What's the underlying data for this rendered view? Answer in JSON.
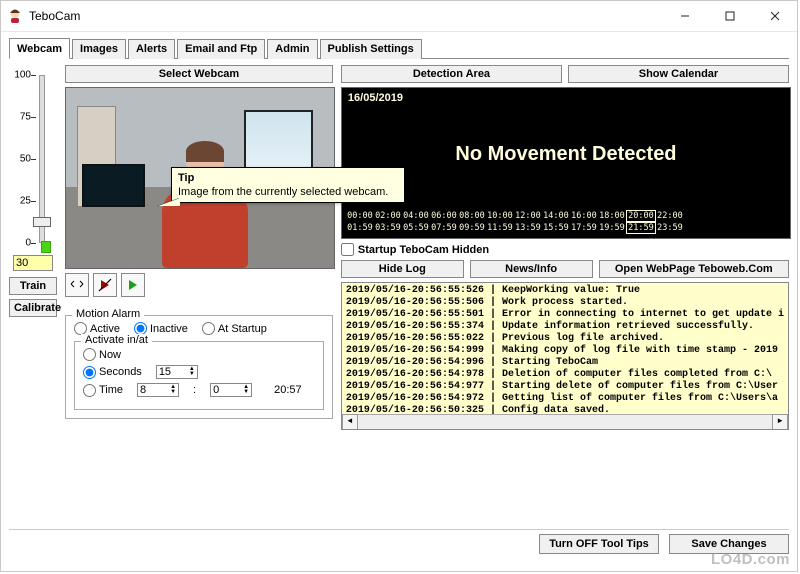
{
  "window": {
    "title": "TeboCam"
  },
  "tabs": [
    "Webcam",
    "Images",
    "Alerts",
    "Email and Ftp",
    "Admin",
    "Publish Settings"
  ],
  "active_tab": 0,
  "slider": {
    "labels": [
      "100",
      "75",
      "50",
      "25",
      "0"
    ],
    "value": "30"
  },
  "buttons": {
    "select_webcam": "Select Webcam",
    "detection_area": "Detection Area",
    "show_calendar": "Show Calendar",
    "train": "Train",
    "calibrate": "Calibrate",
    "hide_log": "Hide Log",
    "news_info": "News/Info",
    "open_webpage": "Open WebPage Teboweb.Com",
    "turn_off_tooltips": "Turn OFF Tool Tips",
    "save_changes": "Save Changes"
  },
  "detection": {
    "date": "16/05/2019",
    "message": "No Movement Detected",
    "timeline_top": [
      "00:00",
      "02:00",
      "04:00",
      "06:00",
      "08:00",
      "10:00",
      "12:00",
      "14:00",
      "16:00",
      "18:00",
      "20:00",
      "22:00"
    ],
    "timeline_bot": [
      "01:59",
      "03:59",
      "05:59",
      "07:59",
      "09:59",
      "11:59",
      "13:59",
      "15:59",
      "17:59",
      "19:59",
      "21:59",
      "23:59"
    ],
    "selected_index": 10
  },
  "startup_hidden": {
    "label": "Startup TeboCam Hidden",
    "checked": false
  },
  "motion_alarm": {
    "legend": "Motion Alarm",
    "state_options": [
      "Active",
      "Inactive",
      "At Startup"
    ],
    "state_selected": 1,
    "activate_legend": "Activate in/at",
    "mode_options": [
      "Now",
      "Seconds",
      "Time"
    ],
    "mode_selected": 1,
    "seconds_value": "15",
    "time_h": "8",
    "time_m": "0",
    "clock": "20:57"
  },
  "log": [
    "2019/05/16-20:56:55:526 | KeepWorking value: True",
    "2019/05/16-20:56:55:506 | Work process started.",
    "2019/05/16-20:56:55:501 | Error in connecting to internet to get update i",
    "2019/05/16-20:56:55:374 | Update information retrieved successfully.",
    "2019/05/16-20:56:55:022 | Previous log file archived.",
    "2019/05/16-20:56:54:999 | Making copy of log file with time stamp - 2019",
    "2019/05/16-20:56:54:996 | Starting TeboCam",
    "2019/05/16-20:56:54:978 | Deletion of computer files completed from C:\\",
    "2019/05/16-20:56:54:977 | Starting delete of computer files from C:\\User",
    "2019/05/16-20:56:54:972 | Getting list of computer files from C:\\Users\\a",
    "2019/05/16-20:56:50:325 | Config data saved."
  ],
  "tooltip": {
    "title": "Tip",
    "body": "Image from the currently selected webcam."
  },
  "watermark": "LO4D.com"
}
